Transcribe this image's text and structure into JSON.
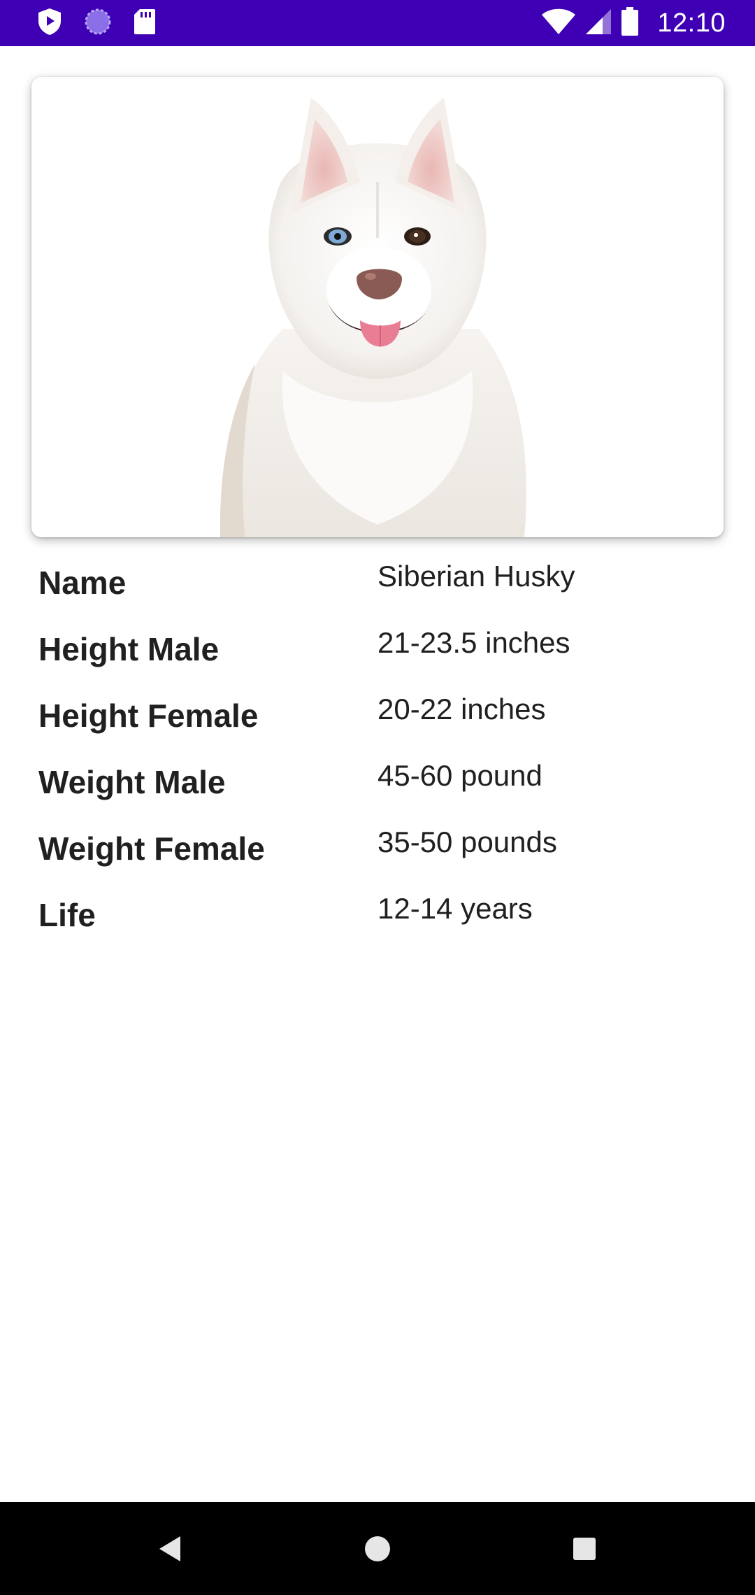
{
  "status_bar": {
    "time": "12:10",
    "left_icons": [
      "shield-icon",
      "sync-icon",
      "sd-card-icon"
    ],
    "right_icons": [
      "wifi-icon",
      "signal-icon",
      "battery-icon"
    ],
    "background": "#3f00b5"
  },
  "card": {
    "image_icon": "white-siberian-husky-photo"
  },
  "details": [
    {
      "label": "Name",
      "value": "Siberian Husky"
    },
    {
      "label": "Height Male",
      "value": "21-23.5 inches"
    },
    {
      "label": "Height Female",
      "value": "20-22 inches"
    },
    {
      "label": "Weight Male",
      "value": "45-60 pound"
    },
    {
      "label": "Weight Female",
      "value": "35-50 pounds"
    },
    {
      "label": "Life",
      "value": "12-14 years"
    }
  ],
  "nav_bar": {
    "buttons": [
      "back-icon",
      "home-icon",
      "recents-icon"
    ]
  }
}
